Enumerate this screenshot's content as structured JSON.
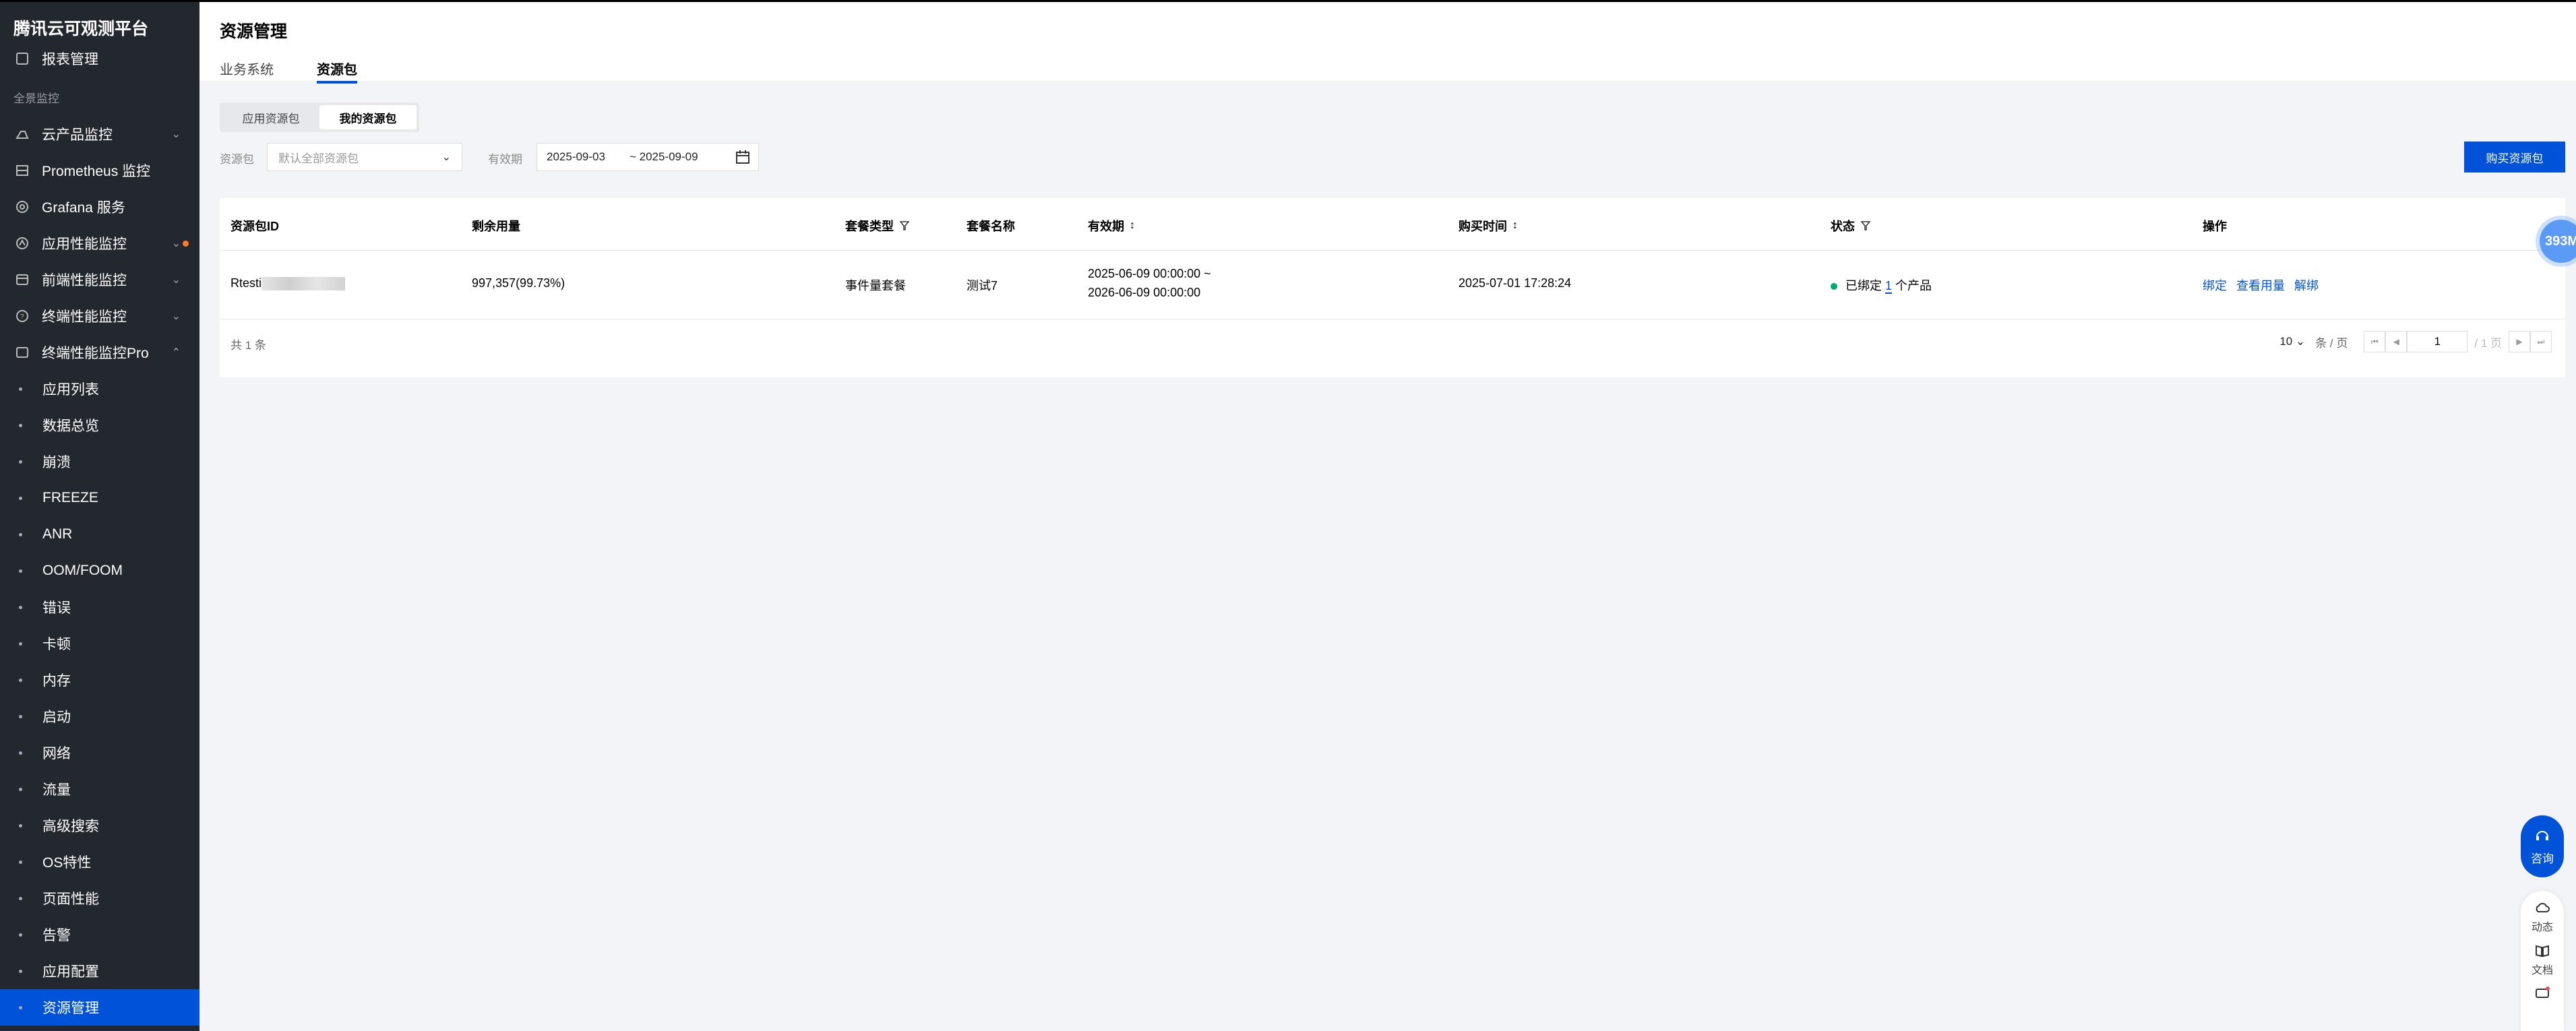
{
  "brand": "腾讯云可观测平台",
  "sidebar": {
    "group_label": "全景监控",
    "items": [
      {
        "label": "报表管理",
        "icon": "report-icon"
      },
      {
        "label": "云产品监控",
        "icon": "cloud-icon"
      },
      {
        "label": "Prometheus 监控",
        "icon": "prometheus-icon"
      },
      {
        "label": "Grafana 服务",
        "icon": "grafana-icon"
      },
      {
        "label": "应用性能监控",
        "icon": "apm-icon"
      },
      {
        "label": "前端性能监控",
        "icon": "frontend-icon"
      },
      {
        "label": "终端性能监控",
        "icon": "terminal-icon"
      },
      {
        "label": "终端性能监控Pro",
        "icon": "terminal-pro-icon"
      }
    ],
    "sub_items": [
      "应用列表",
      "数据总览",
      "崩溃",
      "FREEZE",
      "ANR",
      "OOM/FOOM",
      "错误",
      "卡顿",
      "内存",
      "启动",
      "网络",
      "流量",
      "高级搜索",
      "OS特性",
      "页面性能",
      "告警",
      "应用配置",
      "资源管理"
    ]
  },
  "header": {
    "title": "资源管理",
    "tabs": [
      "业务系统",
      "资源包"
    ]
  },
  "segment": [
    "应用资源包",
    "我的资源包"
  ],
  "filters": {
    "package_label": "资源包",
    "package_placeholder": "默认全部资源包",
    "validity_label": "有效期",
    "date_start": "2025-09-03",
    "date_end": "~ 2025-09-09"
  },
  "buy_button": "购买资源包",
  "table": {
    "headers": [
      "资源包ID",
      "剩余用量",
      "套餐类型",
      "套餐名称",
      "有效期",
      "购买时间",
      "状态",
      "操作"
    ],
    "rows": [
      {
        "id": "Rtesti",
        "remaining": "997,357(99.73%)",
        "type": "事件量套餐",
        "name": "测试7",
        "validity_start": "2025-06-09 00:00:00 ~",
        "validity_end": "2026-06-09 00:00:00",
        "purchase_time": "2025-07-01 17:28:24",
        "status_prefix": "已绑定",
        "status_count": "1",
        "status_suffix": "个产品",
        "actions": [
          "绑定",
          "查看用量",
          "解绑"
        ]
      }
    ]
  },
  "footer": {
    "total": "共 1 条",
    "page_size": "10",
    "page_size_unit": "条 / 页",
    "current_page": "1",
    "total_pages": "/ 1 页"
  },
  "floating": {
    "badge": "393M",
    "consult": "咨询",
    "dynamic": "动态",
    "docs": "文档"
  }
}
